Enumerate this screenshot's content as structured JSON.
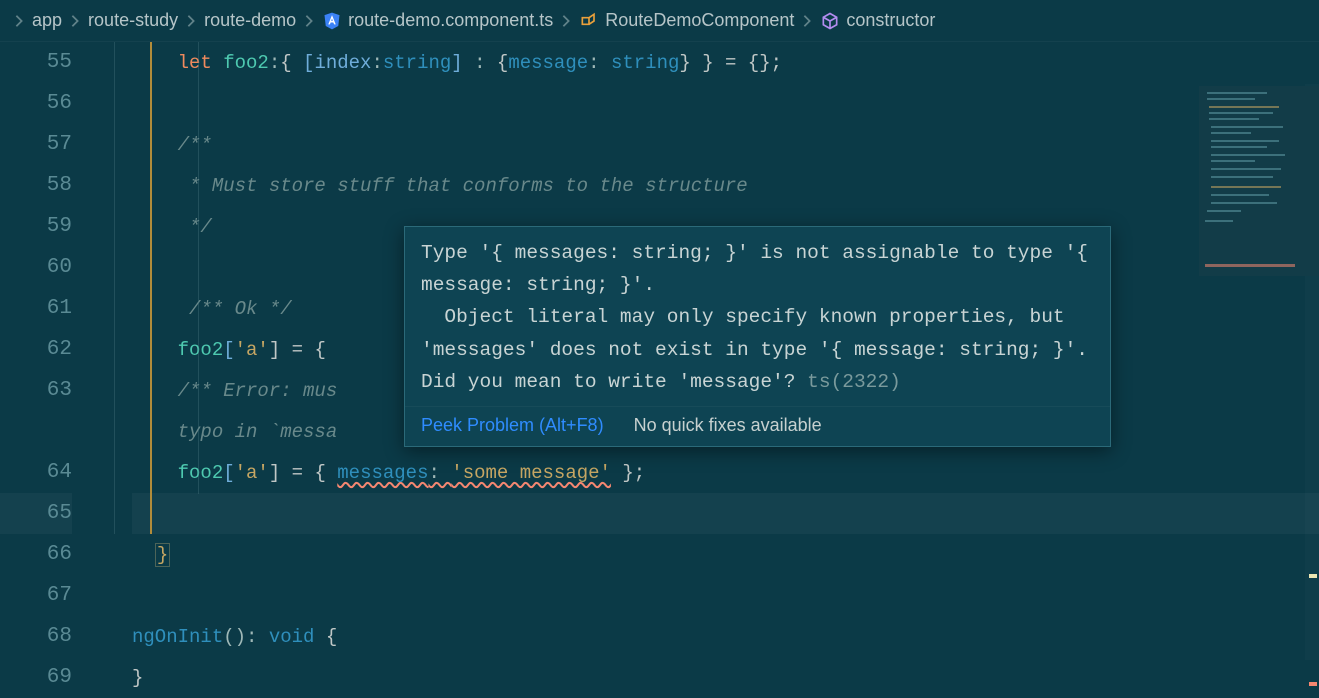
{
  "breadcrumb": [
    {
      "label": "app",
      "icon": null
    },
    {
      "label": "route-study",
      "icon": null
    },
    {
      "label": "route-demo",
      "icon": null
    },
    {
      "label": "route-demo.component.ts",
      "icon": "angular-shield-icon"
    },
    {
      "label": "RouteDemoComponent",
      "icon": "symbol-class-icon"
    },
    {
      "label": "constructor",
      "icon": "symbol-method-icon"
    }
  ],
  "line_numbers": [
    "55",
    "56",
    "57",
    "58",
    "59",
    "60",
    "61",
    "62",
    "63",
    "",
    "64",
    "65",
    "66",
    "67",
    "68",
    "69"
  ],
  "code": {
    "l55_let": "let ",
    "l55_var": "foo2",
    "l55_colon1": ":",
    "l55_open": "{ ",
    "l55_index_open": "[",
    "l55_index_name": "index",
    "l55_index_colon": ":",
    "l55_index_type": "string",
    "l55_index_close": "]",
    "l55_sep": " : ",
    "l55_inner_open": "{",
    "l55_prop": "message",
    "l55_prop_colon": ": ",
    "l55_prop_type": "string",
    "l55_inner_close": "}",
    "l55_close": " } = {};",
    "l57": "/**",
    "l58": " * Must store stuff that conforms to the structure",
    "l59": " */",
    "l61": " /** Ok */",
    "l62_a": "foo2",
    "l62_b": "[",
    "l62_c": "'a'",
    "l62_d": "] = { ",
    "l63_a": "/** Error: mus",
    "l63_b": "typo in `messa",
    "l64_a": "foo2",
    "l64_b": "[",
    "l64_c": "'a'",
    "l64_d": "] = { ",
    "l64_prop": "messages",
    "l64_colon": ": ",
    "l64_val": "'some message'",
    "l64_end": " };",
    "l66": "}",
    "l68_fn": "ngOnInit",
    "l68_paren": "()",
    "l68_colon": ": ",
    "l68_type": "void",
    "l68_open": " {",
    "l69": "}"
  },
  "hover": {
    "line1a": "Type '{ messages: string; }' is not assignable to type '{ message: string; }'.",
    "line2": "  Object literal may only specify known properties, but 'messages' does not exist in type '{ message: string; }'. Did you mean to write 'message'? ",
    "ts_code": "ts(2322)",
    "peek_label": "Peek Problem (Alt+F8)",
    "nofix_label": "No quick fixes available"
  },
  "icons": {
    "angular_color": "#3b82f6",
    "class_color": "#e9a03b",
    "method_color": "#b38cf0"
  }
}
